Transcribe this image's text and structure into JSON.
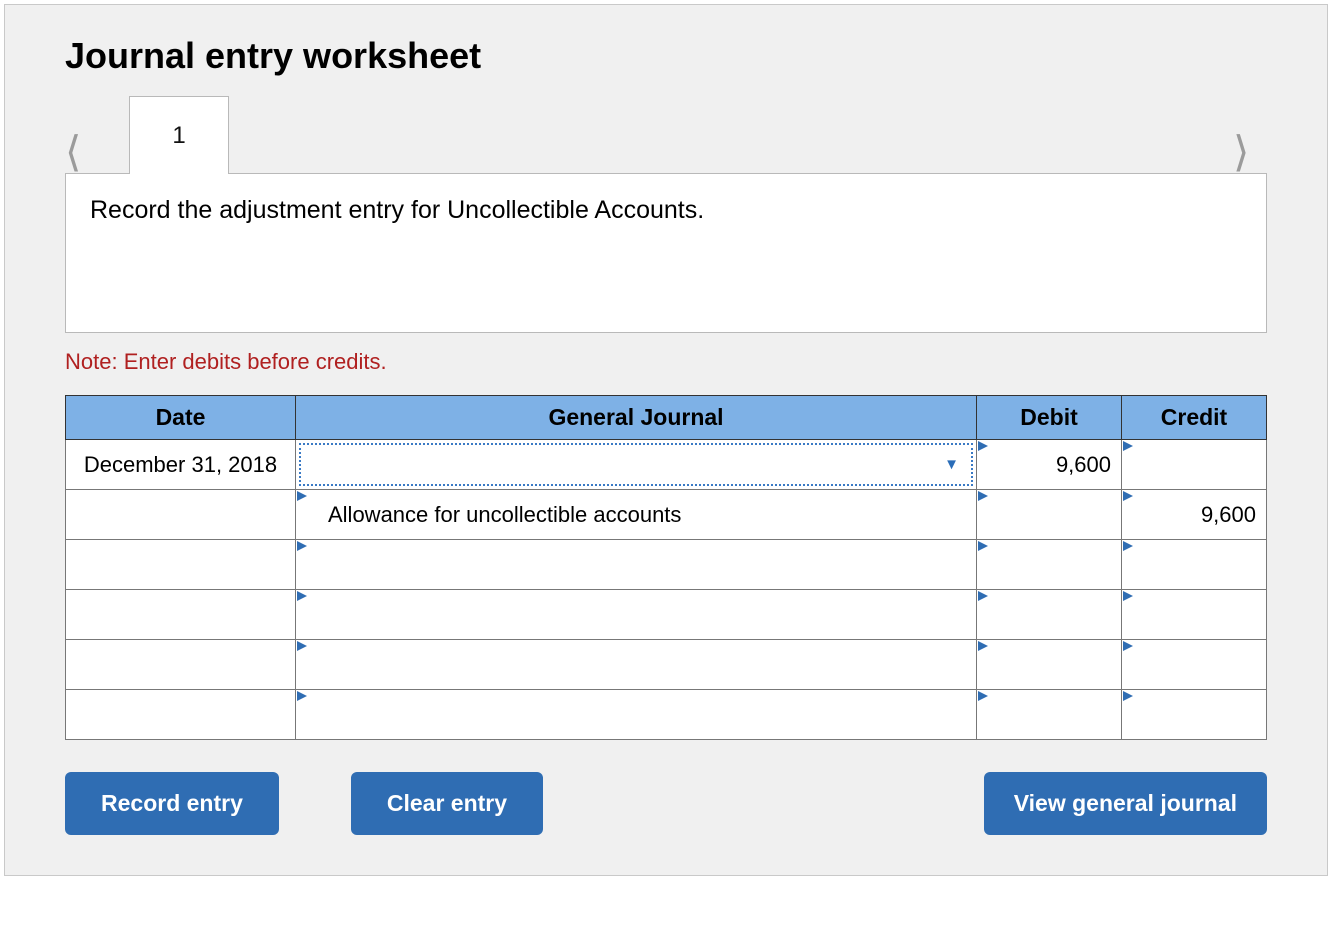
{
  "title": "Journal entry worksheet",
  "tabs": {
    "active": "1"
  },
  "prompt": "Record the adjustment entry for Uncollectible Accounts.",
  "note": "Note: Enter debits before credits.",
  "columns": {
    "date": "Date",
    "general_journal": "General Journal",
    "debit": "Debit",
    "credit": "Credit"
  },
  "rows": [
    {
      "date": "December 31, 2018",
      "general_journal": "",
      "debit": "9,600",
      "credit": ""
    },
    {
      "date": "",
      "general_journal": "Allowance for uncollectible accounts",
      "debit": "",
      "credit": "9,600"
    },
    {
      "date": "",
      "general_journal": "",
      "debit": "",
      "credit": ""
    },
    {
      "date": "",
      "general_journal": "",
      "debit": "",
      "credit": ""
    },
    {
      "date": "",
      "general_journal": "",
      "debit": "",
      "credit": ""
    },
    {
      "date": "",
      "general_journal": "",
      "debit": "",
      "credit": ""
    }
  ],
  "buttons": {
    "record": "Record entry",
    "clear": "Clear entry",
    "view": "View general journal"
  }
}
